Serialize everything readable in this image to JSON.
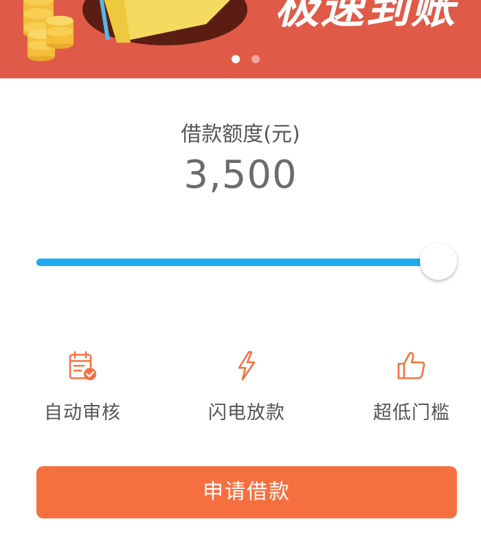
{
  "banner": {
    "headline": "极速到账",
    "slide_count": 2,
    "active_slide": 1,
    "colors": {
      "background": "#e05a48",
      "dot_active": "#ffffff",
      "dot_inactive": "#f2a79a"
    }
  },
  "loan": {
    "label": "借款额度(元)",
    "amount": "3,500",
    "slider_level": 1.0,
    "colors": {
      "track_fill": "#1eabf1"
    }
  },
  "features": [
    {
      "icon": "calendar-check-icon",
      "label": "自动审核"
    },
    {
      "icon": "lightning-icon",
      "label": "闪电放款"
    },
    {
      "icon": "thumbs-up-icon",
      "label": "超低门槛"
    }
  ],
  "accent_color": "#f6703f",
  "apply_button": {
    "label": "申请借款"
  }
}
